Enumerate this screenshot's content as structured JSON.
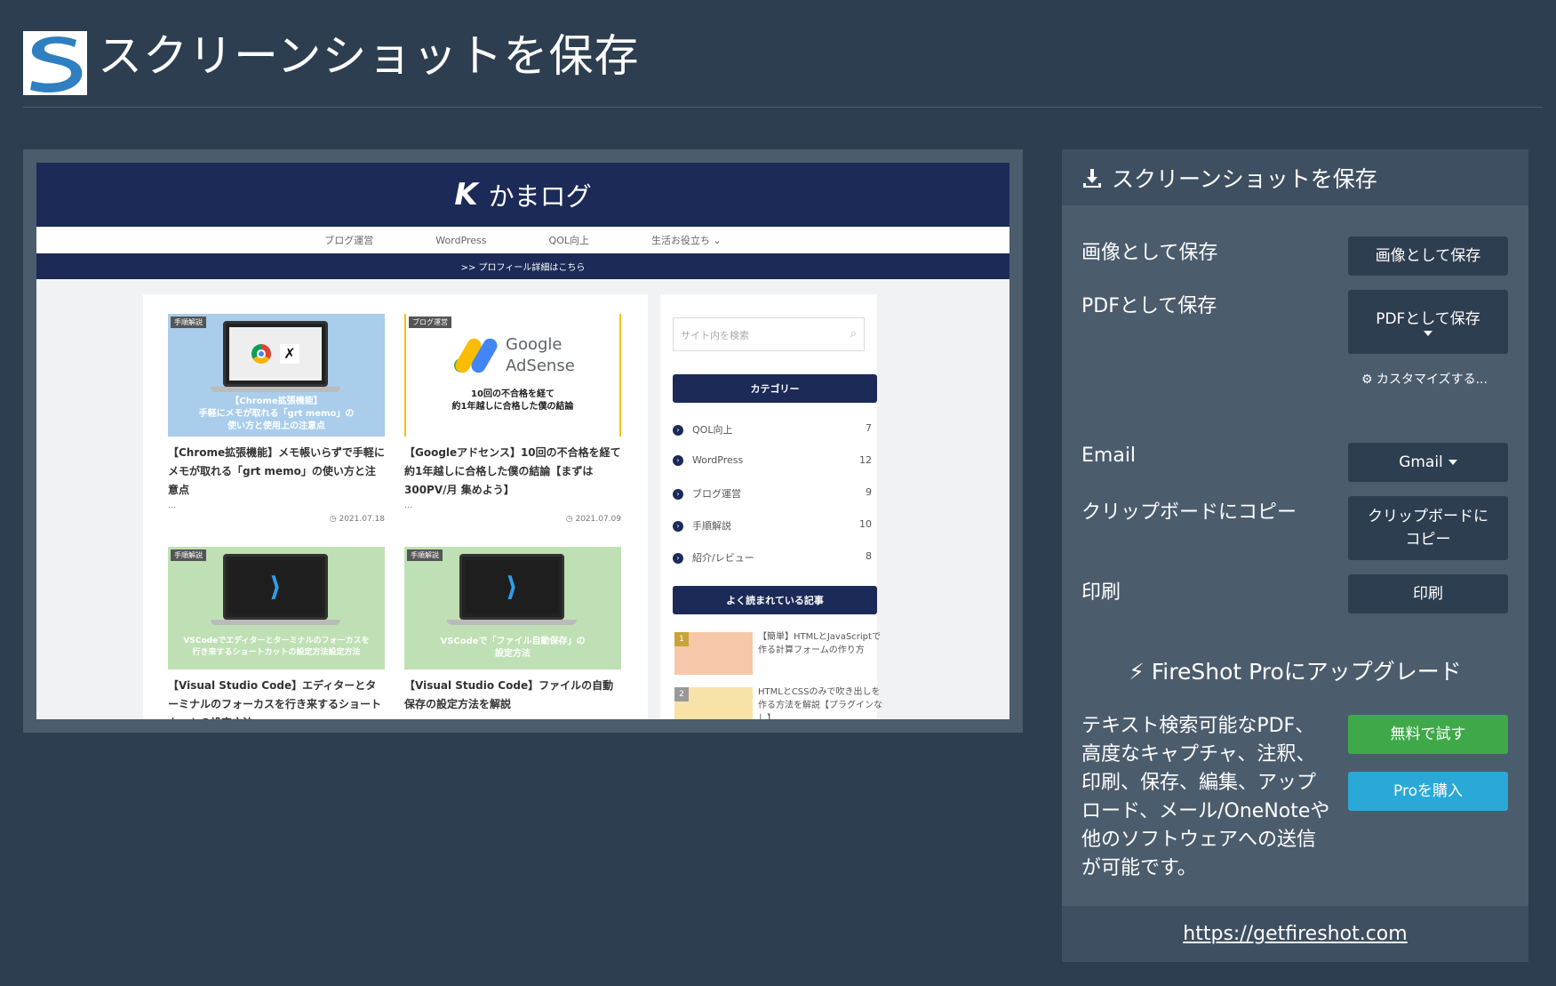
{
  "app": {
    "title": "スクリーンショットを保存"
  },
  "preview": {
    "site_name": "かまログ",
    "nav": [
      "ブログ運営",
      "WordPress",
      "QOL向上",
      "生活お役立ち",
      "⌄"
    ],
    "banner": ">> プロフィール詳細はこちら",
    "posts": [
      {
        "tag": "手順解説",
        "thumb_caption": "【Chrome拡張機能】\n手軽にメモが取れる「grt memo」の\n使い方と使用上の注意点",
        "title": "【Chrome拡張機能】メモ帳いらずで手軽にメモが取れる「grt memo」の使い方と注意点",
        "dots": "…",
        "date": "◷ 2021.07.18"
      },
      {
        "tag": "ブログ運営",
        "thumb_caption": "10回の不合格を経て\n約1年越しに合格した僕の結論",
        "thumb_brand1": "Google",
        "thumb_brand2": "AdSense",
        "title": "【Googleアドセンス】10回の不合格を経て約1年越しに合格した僕の結論【まずは300PV/月 集めよう】",
        "dots": "…",
        "date": "◷ 2021.07.09"
      },
      {
        "tag": "手順解説",
        "thumb_caption": "VSCodeでエディターとターミナルのフォーカスを\n行き来するショートカットの設定方法設定方法",
        "title": "【Visual Studio Code】エディターとターミナルのフォーカスを行き来するショートカットの設定方法"
      },
      {
        "tag": "手順解説",
        "thumb_caption": "VSCodeで「ファイル自動保存」の\n設定方法",
        "title": "【Visual Studio Code】ファイルの自動保存の設定方法を解説"
      }
    ],
    "search_placeholder": "サイト内を検索",
    "category_heading": "カテゴリー",
    "categories": [
      {
        "label": "QOL向上",
        "count": "7"
      },
      {
        "label": "WordPress",
        "count": "12"
      },
      {
        "label": "ブログ運営",
        "count": "9"
      },
      {
        "label": "手順解説",
        "count": "10"
      },
      {
        "label": "紹介/レビュー",
        "count": "8"
      }
    ],
    "popular_heading": "よく読まれている記事",
    "popular": [
      {
        "rank": "1",
        "title": "【簡単】HTMLとJavaScriptで作る計算フォームの作り方"
      },
      {
        "rank": "2",
        "title": "HTMLとCSSのみで吹き出しを作る方法を解説【プラグインなし】"
      }
    ]
  },
  "panel": {
    "header": "スクリーンショットを保存",
    "rows": {
      "image_label": "画像として保存",
      "image_button": "画像として保存",
      "pdf_label": "PDFとして保存",
      "pdf_button": "PDFとして保存",
      "customize": "カスタマイズする...",
      "email_label": "Email",
      "email_button": "Gmail",
      "clipboard_label": "クリップボードにコピー",
      "clipboard_button_line1": "クリップボードに",
      "clipboard_button_line2": "コピー",
      "print_label": "印刷",
      "print_button": "印刷"
    },
    "upgrade_title": "FireShot Proにアップグレード",
    "promo_text": "テキスト検索可能なPDF、高度なキャプチャ、注釈、印刷、保存、編集、アップロード、メール/OneNoteや他のソフトウェアへの送信が可能です。",
    "try_button": "無料で試す",
    "buy_button": "Proを購入",
    "footer_link": "https://getfireshot.com"
  },
  "colors": {
    "background": "#2d3e50",
    "panel": "#4b5c6d",
    "button": "#2d3e50",
    "green": "#3fa94a",
    "blue": "#2aa9d8",
    "site_navy": "#1b2a57"
  }
}
